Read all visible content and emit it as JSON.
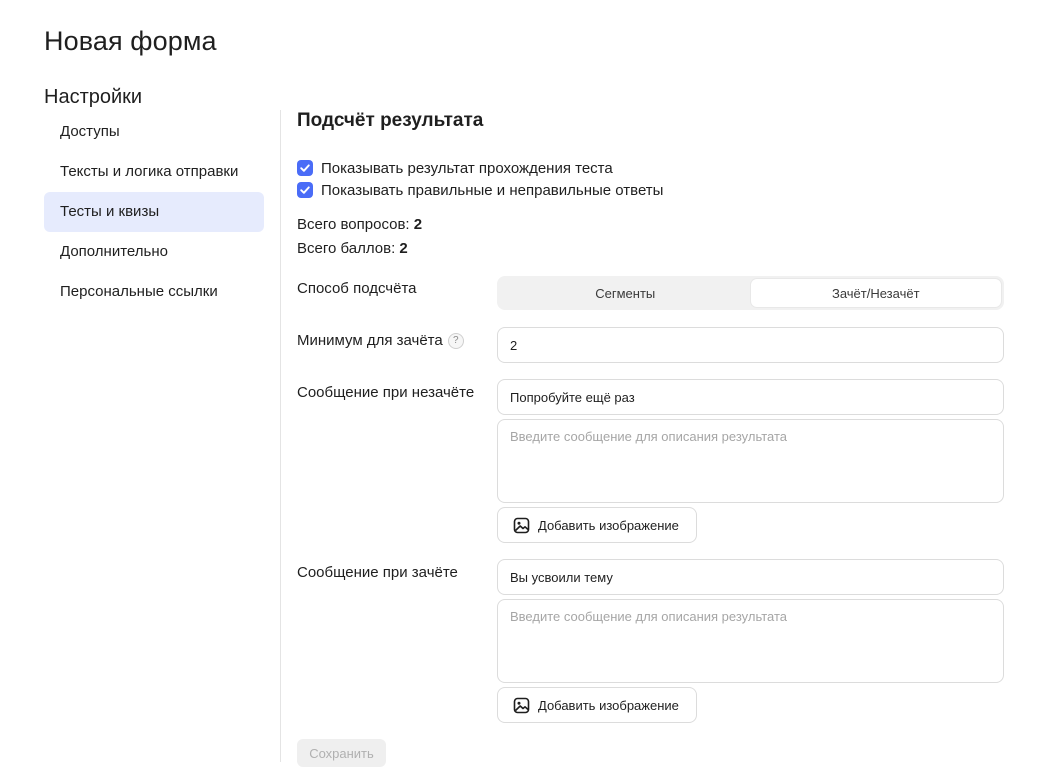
{
  "page_title": "Новая форма",
  "settings_heading": "Настройки",
  "sidebar": {
    "items": [
      {
        "label": "Доступы",
        "active": false
      },
      {
        "label": "Тексты и логика отправки",
        "active": false
      },
      {
        "label": "Тесты и квизы",
        "active": true
      },
      {
        "label": "Дополнительно",
        "active": false
      },
      {
        "label": "Персональные ссылки",
        "active": false
      }
    ]
  },
  "section_title": "Подсчёт результата",
  "checkboxes": [
    {
      "label": "Показывать результат прохождения теста",
      "checked": true
    },
    {
      "label": "Показывать правильные и неправильные ответы",
      "checked": true
    }
  ],
  "stats": {
    "questions_label": "Всего вопросов:",
    "questions_value": "2",
    "points_label": "Всего баллов:",
    "points_value": "2"
  },
  "scoring": {
    "label": "Способ подсчёта",
    "options": [
      "Сегменты",
      "Зачёт/Незачёт"
    ],
    "selected": "Зачёт/Незачёт"
  },
  "minimum": {
    "label": "Минимум для зачёта",
    "help": "?",
    "value": "2"
  },
  "fail_message": {
    "label": "Сообщение при незачёте",
    "value": "Попробуйте ещё раз",
    "description_placeholder": "Введите сообщение для описания результата",
    "add_image_label": "Добавить изображение"
  },
  "pass_message": {
    "label": "Сообщение при зачёте",
    "value": "Вы усвоили тему",
    "description_placeholder": "Введите сообщение для описания результата",
    "add_image_label": "Добавить изображение"
  },
  "save_label": "Сохранить",
  "colors": {
    "accent": "#4a6cf7",
    "active_nav_bg": "#e6ebfd"
  }
}
